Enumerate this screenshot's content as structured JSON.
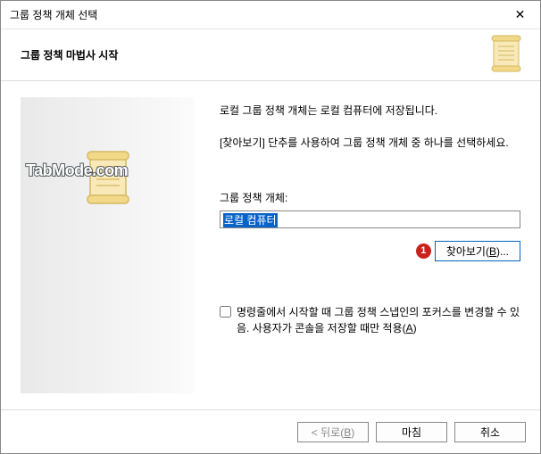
{
  "window": {
    "title": "그룹 정책 개체 선택",
    "close": "✕"
  },
  "header": {
    "subtitle": "그룹 정책 마법사 시작"
  },
  "leftpane": {
    "watermark": "TabMode.com"
  },
  "main": {
    "desc1": "로컬 그룹 정책 개체는 로컬 컴퓨터에 저장됩니다.",
    "desc2": "[찾아보기] 단추를 사용하여 그룹 정책 개체 중 하나를 선택하세요.",
    "field_label": "그룹 정책 개체:",
    "field_value": "로컬 컴퓨터",
    "badge": "1",
    "browse_label": "찾아보기(B)...",
    "checkbox_label": "명령줄에서 시작할 때 그룹 정책 스냅인의 포커스를 변경할 수 있음. 사용자가 콘솔을 저장할 때만 적용(A)"
  },
  "footer": {
    "back": "< 뒤로(B)",
    "finish": "마침",
    "cancel": "취소"
  }
}
